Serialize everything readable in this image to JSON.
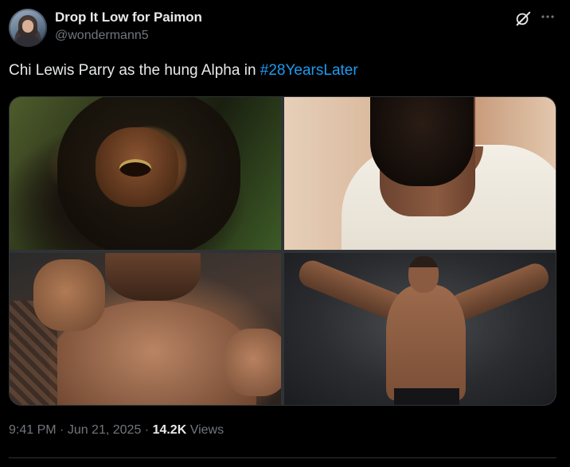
{
  "author": {
    "display_name": "Drop It Low for Paimon",
    "handle": "@wondermann5"
  },
  "tweet": {
    "text": "Chi Lewis Parry as the hung Alpha in ",
    "hashtag": "#28YearsLater"
  },
  "media": [
    {
      "alt": "bearded man with wild hair in film still"
    },
    {
      "alt": "close-up of bearded man in white t-shirt"
    },
    {
      "alt": "shirtless boxer with raised fists"
    },
    {
      "alt": "muscular man flexing against dark background"
    }
  ],
  "meta": {
    "time": "9:41 PM",
    "sep1": " · ",
    "date": "Jun 21, 2025",
    "sep2": " · ",
    "views_count": "14.2K",
    "views_label": " Views"
  },
  "icons": {
    "grok": "grok-icon",
    "more": "more-icon"
  },
  "colors": {
    "background": "#000000",
    "text": "#e7e9ea",
    "secondary": "#71767b",
    "link": "#1d9bf0"
  }
}
